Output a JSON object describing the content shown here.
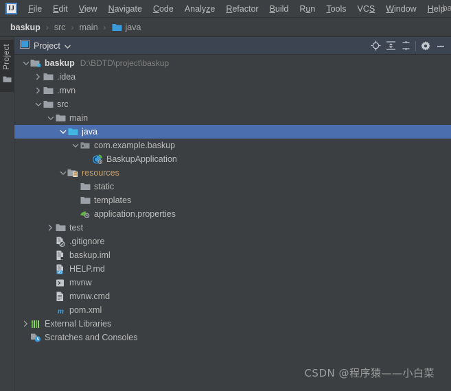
{
  "window": {
    "title": "bask"
  },
  "menubar": {
    "logo": "ij-logo-icon",
    "items": [
      {
        "label": "File",
        "mnemonic": "F"
      },
      {
        "label": "Edit",
        "mnemonic": "E"
      },
      {
        "label": "View",
        "mnemonic": "V"
      },
      {
        "label": "Navigate",
        "mnemonic": "N"
      },
      {
        "label": "Code",
        "mnemonic": "C"
      },
      {
        "label": "Analyze",
        "mnemonic": "z"
      },
      {
        "label": "Refactor",
        "mnemonic": "R"
      },
      {
        "label": "Build",
        "mnemonic": "B"
      },
      {
        "label": "Run",
        "mnemonic": "u"
      },
      {
        "label": "Tools",
        "mnemonic": "T"
      },
      {
        "label": "VCS",
        "mnemonic": "S"
      },
      {
        "label": "Window",
        "mnemonic": "W"
      },
      {
        "label": "Help",
        "mnemonic": "H"
      }
    ]
  },
  "breadcrumb": {
    "items": [
      "baskup",
      "src",
      "main",
      "java"
    ],
    "separator": "›"
  },
  "toolstrip": {
    "project_tab_label": "Project"
  },
  "panel": {
    "title": "Project",
    "dropdown_icon": "chevron-down-icon",
    "buttons": [
      {
        "name": "select-opened-file-button",
        "icon": "locate-crosshair-icon"
      },
      {
        "name": "expand-all-button",
        "icon": "expand-all-icon"
      },
      {
        "name": "collapse-all-button",
        "icon": "collapse-all-icon"
      },
      {
        "name": "settings-button",
        "icon": "gear-icon"
      },
      {
        "name": "hide-button",
        "icon": "minimize-icon"
      }
    ]
  },
  "colors": {
    "selection": "#4b6eaf",
    "tree_background": "#3c3f41",
    "panel_header": "#3c4452",
    "menubar": "#3c4043",
    "source_root_label": "#c9a26d",
    "accent_blue": "#3b9ad9",
    "folder_gray": "#9aa0a6",
    "folder_blue": "#40b6e0",
    "text": "#bbbbbb"
  },
  "tree": {
    "rows": [
      {
        "label": "baskup",
        "indent": 0,
        "arrow": "down",
        "icon": "module-folder-icon",
        "bold": true,
        "hint": "D:\\BDTD\\project\\baskup",
        "selected": false
      },
      {
        "label": ".idea",
        "indent": 1,
        "arrow": "right",
        "icon": "folder-icon",
        "selected": false
      },
      {
        "label": ".mvn",
        "indent": 1,
        "arrow": "right",
        "icon": "folder-icon",
        "selected": false
      },
      {
        "label": "src",
        "indent": 1,
        "arrow": "down",
        "icon": "folder-icon",
        "selected": false
      },
      {
        "label": "main",
        "indent": 2,
        "arrow": "down",
        "icon": "folder-icon",
        "selected": false
      },
      {
        "label": "java",
        "indent": 3,
        "arrow": "down",
        "icon": "source-folder-icon",
        "selected": true
      },
      {
        "label": "com.example.baskup",
        "indent": 4,
        "arrow": "down",
        "icon": "package-icon",
        "selected": false
      },
      {
        "label": "BaskupApplication",
        "indent": 5,
        "arrow": "none",
        "icon": "spring-class-icon",
        "selected": false
      },
      {
        "label": "resources",
        "indent": 3,
        "arrow": "down",
        "icon": "resource-folder-icon",
        "source": true,
        "selected": false
      },
      {
        "label": "static",
        "indent": 4,
        "arrow": "none",
        "icon": "folder-icon",
        "selected": false
      },
      {
        "label": "templates",
        "indent": 4,
        "arrow": "none",
        "icon": "folder-icon",
        "selected": false
      },
      {
        "label": "application.properties",
        "indent": 4,
        "arrow": "none",
        "icon": "properties-file-icon",
        "selected": false
      },
      {
        "label": "test",
        "indent": 2,
        "arrow": "right",
        "icon": "folder-icon",
        "selected": false
      },
      {
        "label": ".gitignore",
        "indent": 2,
        "arrow": "none",
        "icon": "gitignore-file-icon",
        "selected": false
      },
      {
        "label": "baskup.iml",
        "indent": 2,
        "arrow": "none",
        "icon": "iml-file-icon",
        "selected": false
      },
      {
        "label": "HELP.md",
        "indent": 2,
        "arrow": "none",
        "icon": "markdown-file-icon",
        "selected": false
      },
      {
        "label": "mvnw",
        "indent": 2,
        "arrow": "none",
        "icon": "shell-script-icon",
        "selected": false
      },
      {
        "label": "mvnw.cmd",
        "indent": 2,
        "arrow": "none",
        "icon": "text-file-icon",
        "selected": false
      },
      {
        "label": "pom.xml",
        "indent": 2,
        "arrow": "none",
        "icon": "maven-file-icon",
        "selected": false
      },
      {
        "label": "External Libraries",
        "indent": 0,
        "arrow": "right",
        "icon": "libraries-icon",
        "selected": false
      },
      {
        "label": "Scratches and Consoles",
        "indent": 0,
        "arrow": "none",
        "icon": "scratches-icon",
        "selected": false
      }
    ]
  },
  "watermark": {
    "text": "CSDN @程序猿——小白菜"
  }
}
